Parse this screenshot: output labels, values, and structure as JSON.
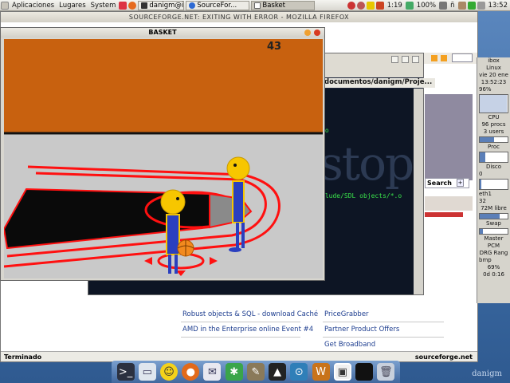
{
  "top_panel": {
    "menus": [
      "Aplicaciones",
      "Lugares",
      "System"
    ],
    "tasks": [
      "danigm@i...",
      "SourceFor...",
      "Basket"
    ],
    "clock": "1:19",
    "battery": "100%",
    "time_right": "13:52",
    "keyboard": "ñ"
  },
  "firefox": {
    "title": "SOURCEFORGE.NET: EXITING WITH ERROR - MOZILLA FIREFOX",
    "status_left": "Terminado",
    "status_right": "sourceforge.net",
    "search_label": "Search",
    "links": [
      "Robust objects & SQL - download Caché",
      "PriceGrabber",
      "AMD in the Enterprise online Event #4",
      "Partner Product Offers",
      "Get Broadband"
    ]
  },
  "terminal": {
    "path": "documentos/danigm/Proje...",
    "lines": [
      ".o",
      "clude/SDL objects/*.o"
    ],
    "bg_word": "stop"
  },
  "basket": {
    "title": "BASKET",
    "score": "43"
  },
  "sysmon": {
    "host": "ibox",
    "os": "Linux",
    "date": "vie  20 ene",
    "time": "13:52:23",
    "load": "96%",
    "cpu_label": "CPU",
    "procs": "96 procs",
    "users": "3 users",
    "proc_label": "Proc",
    "disk_label": "Disco",
    "disk_val": "0",
    "eth": "eth1",
    "eth_val": "32",
    "mem": "72M libre",
    "swap": "Swap",
    "master": "Master",
    "pcm": "PCM",
    "drg": "DRG Rang",
    "bmp": "bmp",
    "percent": "69%",
    "uptime": "0d 0:16"
  },
  "colors": {
    "court_wall": "#c8610f",
    "court_floor": "#c9c9c9",
    "court_line": "#ff1010",
    "player_head": "#f7c600",
    "player_body": "#2a3fbf",
    "ball": "#f28a1e"
  },
  "desktop_label": "danigm"
}
